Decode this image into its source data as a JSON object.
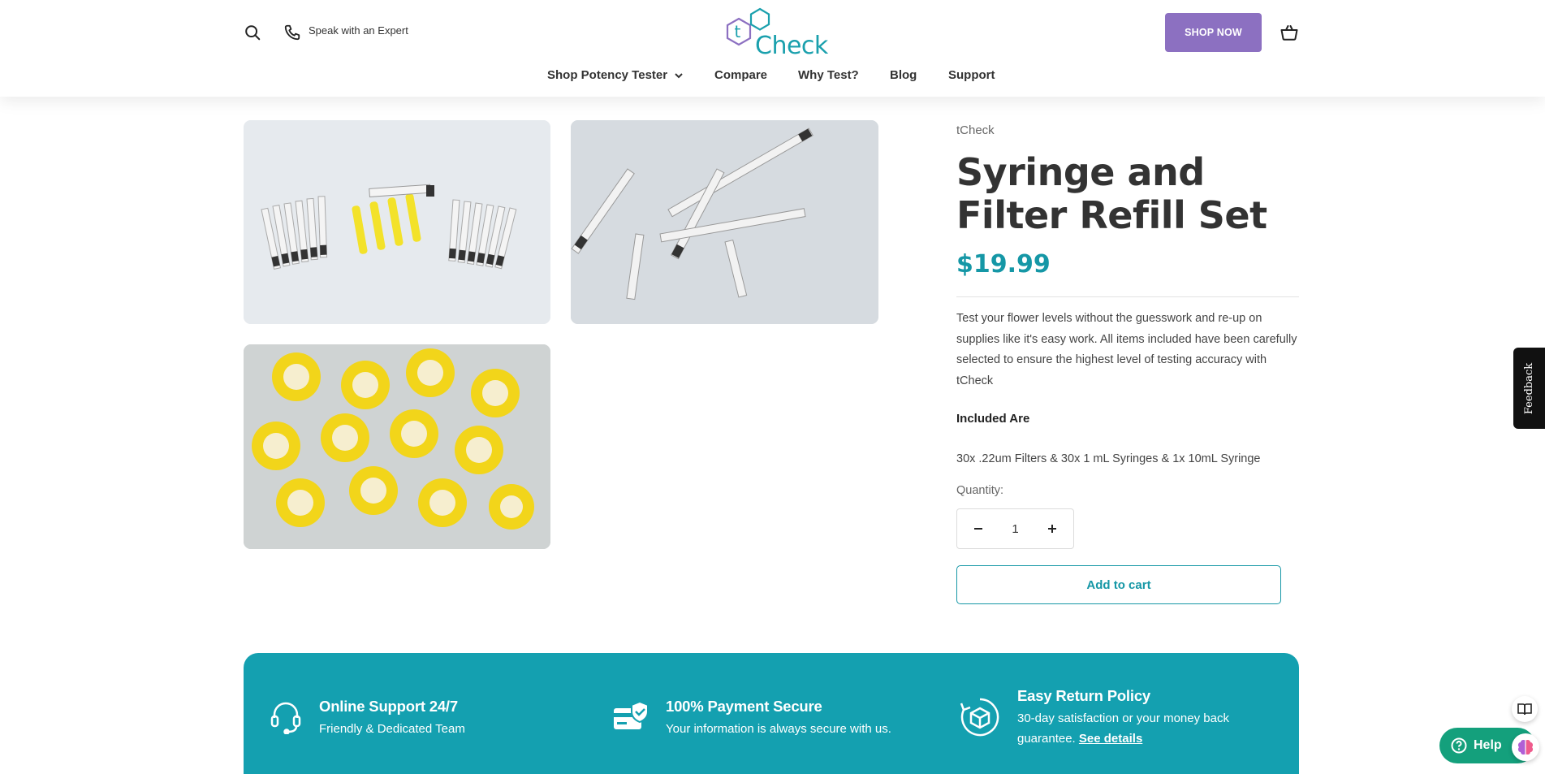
{
  "header": {
    "expert_label": "Speak with an Expert",
    "logo_text": "Check",
    "logo_letter": "t",
    "shop_now_label": "SHOP NOW"
  },
  "nav": {
    "items": [
      {
        "label": "Shop Potency Tester",
        "has_dropdown": true
      },
      {
        "label": "Compare"
      },
      {
        "label": "Why Test?"
      },
      {
        "label": "Blog"
      },
      {
        "label": "Support"
      }
    ]
  },
  "product": {
    "vendor": "tCheck",
    "title": "Syringe and Filter Refill Set",
    "price": "$19.99",
    "description": "Test your flower levels without the guesswork and re-up on supplies like it's easy work. All items included have been carefully selected to ensure the highest level of testing accuracy with tCheck",
    "included_heading": "Included Are",
    "included_items": "30x .22um Filters & 30x 1 mL Syringes & 1x 10mL Syringe",
    "quantity_label": "Quantity:",
    "quantity_value": "1",
    "add_to_cart_label": "Add to cart"
  },
  "trust": [
    {
      "title": "Online Support 24/7",
      "sub": "Friendly & Dedicated Team",
      "icon": "headset-icon"
    },
    {
      "title": "100% Payment Secure",
      "sub": "Your information is always secure with us.",
      "icon": "secure-card-icon"
    },
    {
      "title": "Easy Return Policy",
      "sub": "30-day satisfaction or your money back guarantee.",
      "link": "See details",
      "icon": "return-box-icon"
    }
  ],
  "widgets": {
    "feedback_label": "Feedback",
    "help_label": "Help"
  },
  "colors": {
    "accent": "#1597a6",
    "trust_bg": "#14a0b0",
    "shop_now_bg": "#8c70c1",
    "help_bg": "#14a07c"
  }
}
